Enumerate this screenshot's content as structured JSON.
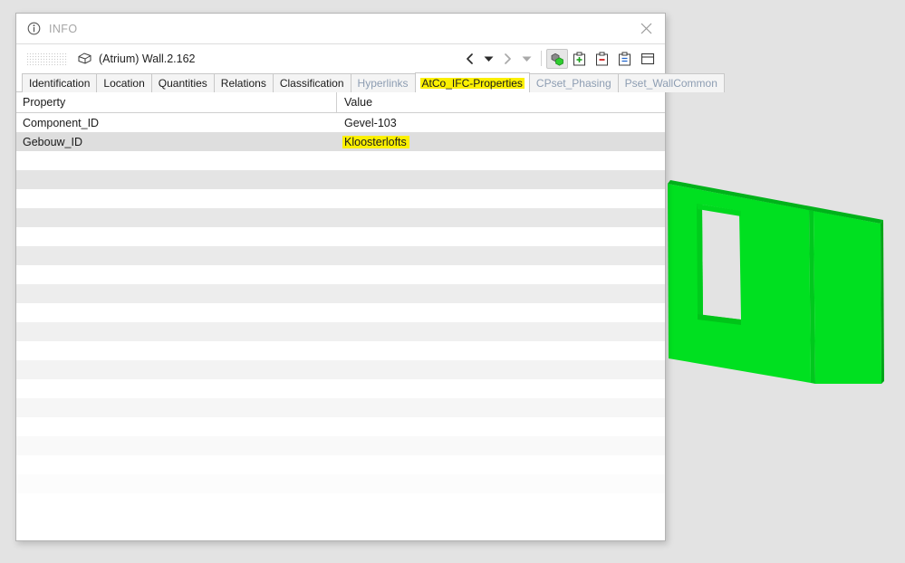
{
  "window": {
    "title": "INFO",
    "info_icon": "info-circle-icon",
    "close_icon": "close-icon"
  },
  "object": {
    "grip_icon": "drag-grip-icon",
    "type_icon": "ifc-wall-box-icon",
    "name": "(Atrium) Wall.2.162"
  },
  "toolbar": {
    "buttons": [
      {
        "name": "nav-back-button",
        "icon": "chevron-left-icon",
        "enabled": true
      },
      {
        "name": "nav-back-dropdown",
        "icon": "caret-down-icon",
        "enabled": true
      },
      {
        "name": "nav-forward-button",
        "icon": "chevron-right-icon",
        "enabled": false
      },
      {
        "name": "nav-forward-dropdown",
        "icon": "caret-down-icon",
        "enabled": false
      },
      {
        "name": "select-related-button",
        "icon": "green-cubes-icon",
        "enabled": true,
        "active": true
      },
      {
        "name": "add-to-selection-button",
        "icon": "clipboard-plus-icon",
        "enabled": true
      },
      {
        "name": "remove-from-selection-button",
        "icon": "clipboard-minus-icon",
        "enabled": true
      },
      {
        "name": "list-selection-button",
        "icon": "clipboard-list-icon",
        "enabled": true
      },
      {
        "name": "layout-panel-button",
        "icon": "panel-layout-icon",
        "enabled": true
      }
    ]
  },
  "tabs": [
    {
      "label": "Identification",
      "state": "normal"
    },
    {
      "label": "Location",
      "state": "normal"
    },
    {
      "label": "Quantities",
      "state": "normal"
    },
    {
      "label": "Relations",
      "state": "normal"
    },
    {
      "label": "Classification",
      "state": "normal"
    },
    {
      "label": "Hyperlinks",
      "state": "muted"
    },
    {
      "label": "AtCo_IFC-Properties",
      "state": "active",
      "highlight": true
    },
    {
      "label": "CPset_Phasing",
      "state": "muted"
    },
    {
      "label": "Pset_WallCommon",
      "state": "muted"
    }
  ],
  "table": {
    "headers": {
      "property": "Property",
      "value": "Value"
    },
    "rows": [
      {
        "property": "Component_ID",
        "value": "Gevel-103",
        "selected": false,
        "value_highlight": false
      },
      {
        "property": "Gebouw_ID",
        "value": "Kloosterlofts",
        "selected": true,
        "value_highlight": true
      }
    ],
    "empty_row_count": 20
  },
  "viewport": {
    "name": "3d-model-viewport",
    "background_color": "#e3e3e3",
    "element_color": "#00e020",
    "element_edge_color": "#00b21a",
    "opening_color": "#e3e3e3",
    "description": "selected-wall-with-window-opening"
  },
  "colors": {
    "highlight_yellow": "#fbf000",
    "selection_gray": "#dedede",
    "muted_tab_text": "#8d9db2",
    "title_text": "#a6a6a6"
  }
}
